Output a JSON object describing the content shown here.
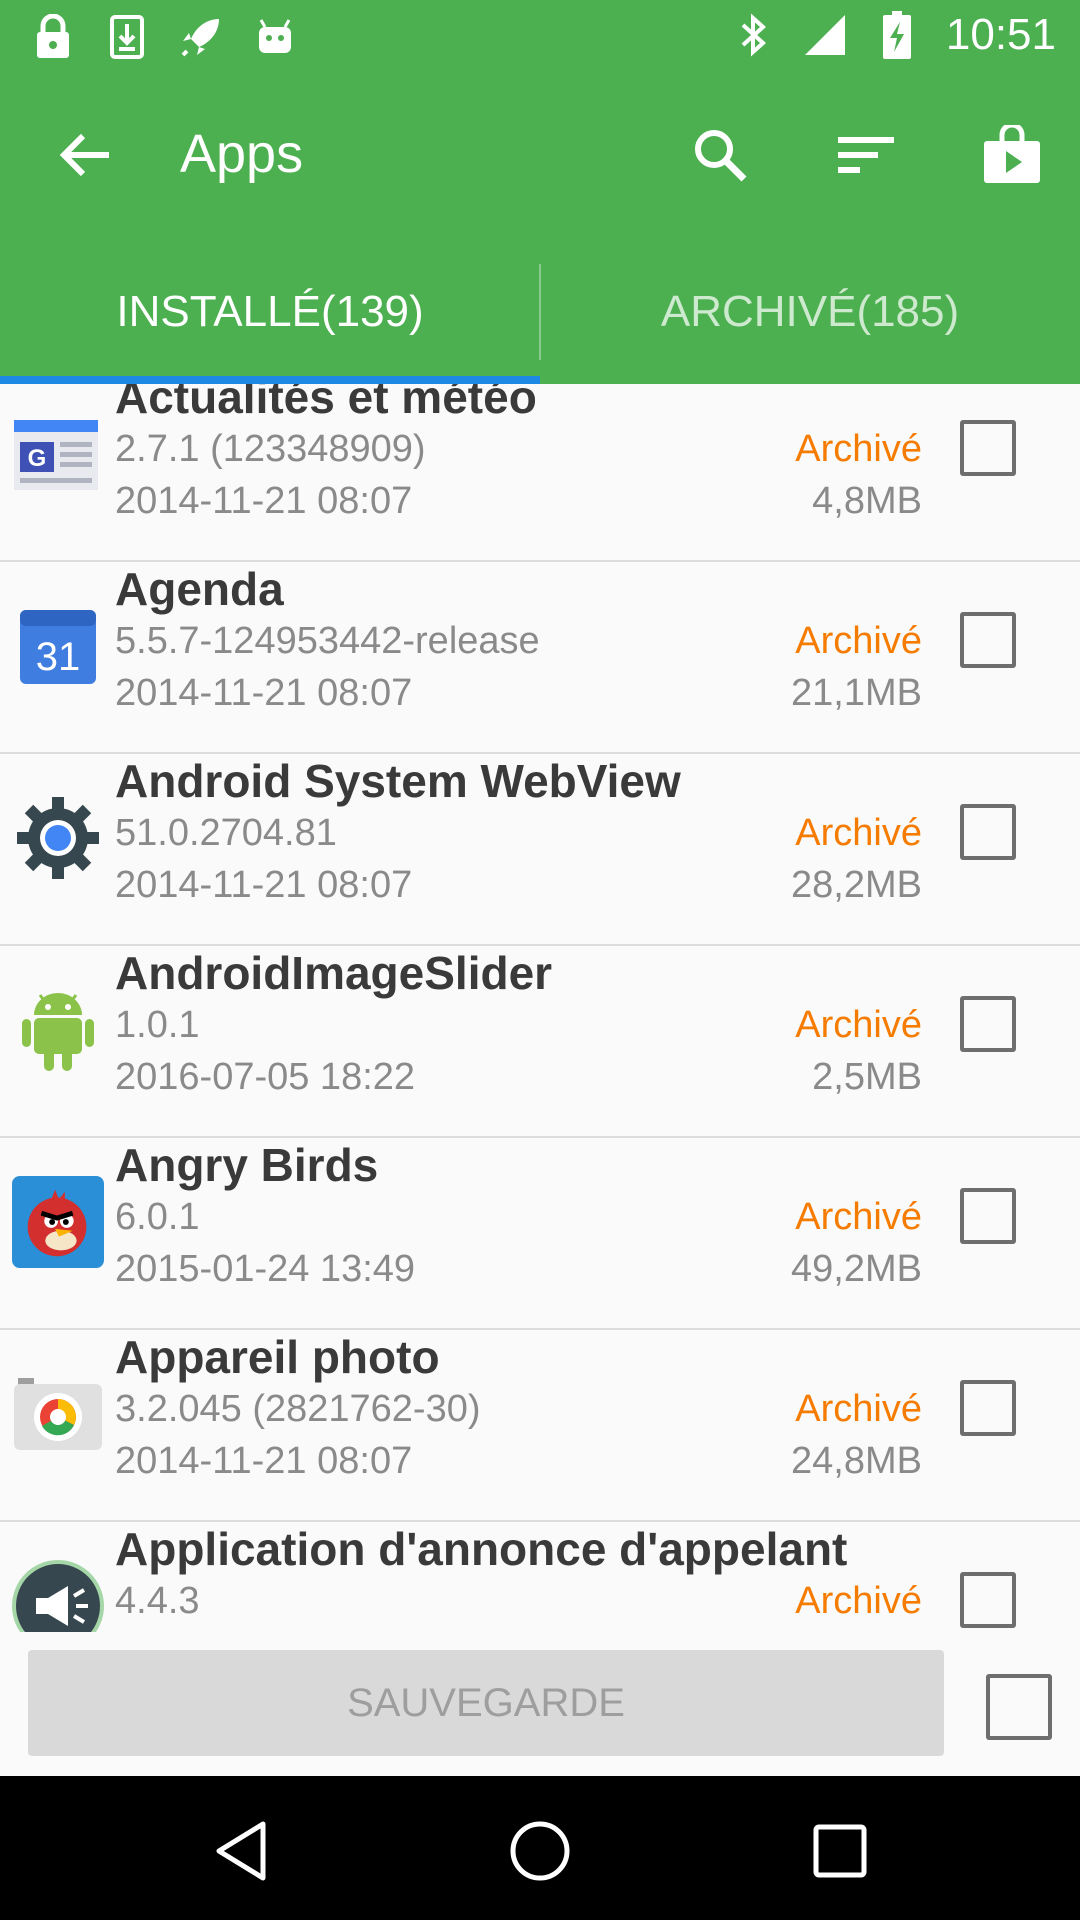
{
  "status_bar": {
    "time": "10:51",
    "left_icons": [
      "lock-icon",
      "download-icon",
      "rocket-icon",
      "android-head-icon"
    ],
    "right_icons": [
      "bluetooth-icon",
      "signal-icon",
      "battery-charging-icon"
    ]
  },
  "appbar": {
    "title": "Apps",
    "actions": [
      "search-icon",
      "sort-icon",
      "play-store-icon"
    ]
  },
  "tabs": {
    "installed": "INSTALLÉ(139)",
    "archived": "ARCHIVÉ(185)"
  },
  "apps": [
    {
      "name": "Actualités et météo",
      "version": "2.7.1 (123348909)",
      "date": "2014-11-21 08:07",
      "status": "Archivé",
      "size": "4,8MB",
      "icon": "news-weather-icon"
    },
    {
      "name": "Agenda",
      "version": "5.5.7-124953442-release",
      "date": "2014-11-21 08:07",
      "status": "Archivé",
      "size": "21,1MB",
      "icon": "calendar-icon"
    },
    {
      "name": "Android System WebView",
      "version": "51.0.2704.81",
      "date": "2014-11-21 08:07",
      "status": "Archivé",
      "size": "28,2MB",
      "icon": "webview-gear-icon"
    },
    {
      "name": "AndroidImageSlider",
      "version": "1.0.1",
      "date": "2016-07-05 18:22",
      "status": "Archivé",
      "size": "2,5MB",
      "icon": "android-robot-icon"
    },
    {
      "name": "Angry Birds",
      "version": "6.0.1",
      "date": "2015-01-24 13:49",
      "status": "Archivé",
      "size": "49,2MB",
      "icon": "angry-birds-icon"
    },
    {
      "name": "Appareil photo",
      "version": "3.2.045 (2821762-30)",
      "date": "2014-11-21 08:07",
      "status": "Archivé",
      "size": "24,8MB",
      "icon": "camera-icon"
    },
    {
      "name": "Application d'annonce d'appelant",
      "version": "4.4.3",
      "date": "",
      "status": "Archivé",
      "size": "",
      "icon": "caller-announce-icon"
    }
  ],
  "bottom": {
    "save_label": "SAUVEGARDE"
  },
  "colors": {
    "primary": "#4caf50",
    "tab_indicator": "#1e88e5",
    "status_text": "#f57c00"
  },
  "nav": [
    "back-triangle-icon",
    "home-circle-icon",
    "recents-square-icon"
  ]
}
